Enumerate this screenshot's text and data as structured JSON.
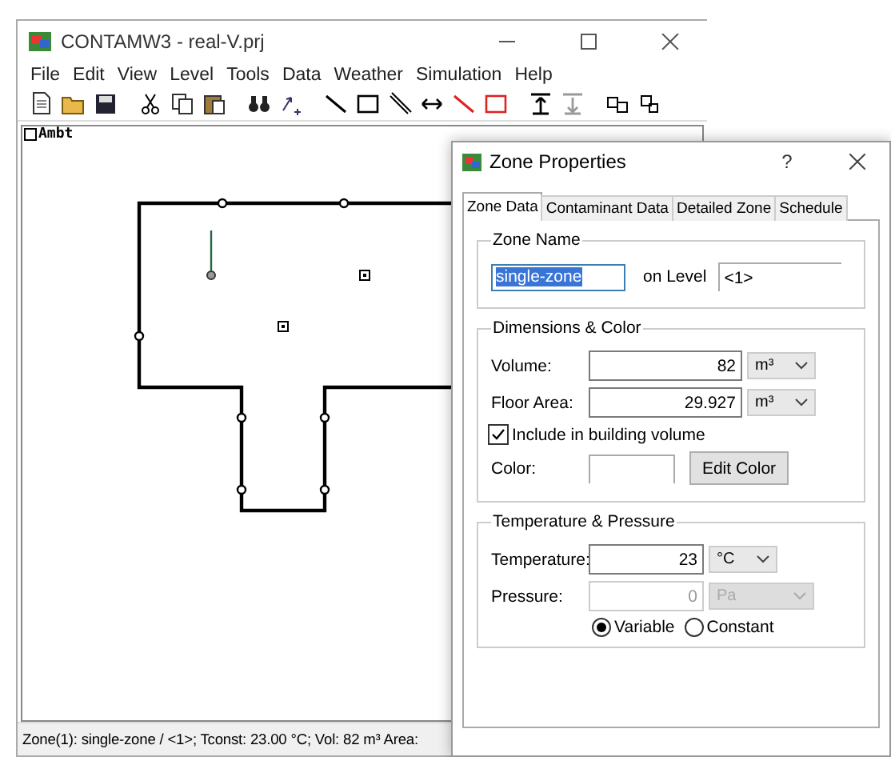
{
  "main_window": {
    "title": "CONTAMW3 - real-V.prj",
    "menu": [
      "File",
      "Edit",
      "View",
      "Level",
      "Tools",
      "Data",
      "Weather",
      "Simulation",
      "Help"
    ],
    "level_label": "Ambt",
    "status_bar": "Zone(1): single-zone / <1>; Tconst: 23.00 °C; Vol: 82 m³  Area:"
  },
  "dialog": {
    "title": "Zone Properties",
    "help": "?",
    "tabs": [
      {
        "label": "Zone Data",
        "selected": true
      },
      {
        "label": "Contaminant Data",
        "selected": false
      },
      {
        "label": "Detailed Zone",
        "selected": false
      },
      {
        "label": "Schedule",
        "selected": false
      }
    ],
    "zone_name": {
      "legend": "Zone Name",
      "value": "single-zone",
      "selected": true,
      "level_label": "on Level",
      "level_value": "<1>"
    },
    "dimensions": {
      "legend": "Dimensions & Color",
      "fields": [
        {
          "label": "Volume:",
          "value": "82",
          "unit": "m³",
          "disabled": false
        },
        {
          "label": "Floor Area:",
          "value": "29.927",
          "unit": "m³",
          "disabled": false
        }
      ],
      "include": {
        "label": "Include in building volume",
        "checked": true
      },
      "color_label": "Color:",
      "edit_color": "Edit Color"
    },
    "temperature": {
      "legend": "Temperature & Pressure",
      "fields": [
        {
          "label": "Temperature:",
          "value": "23",
          "unit": "°C",
          "disabled": false
        },
        {
          "label": "Pressure:",
          "value": "0",
          "unit": "Pa",
          "disabled": true
        }
      ],
      "radios": [
        {
          "label": "Variable",
          "selected": true
        },
        {
          "label": "Constant",
          "selected": false
        }
      ]
    }
  }
}
